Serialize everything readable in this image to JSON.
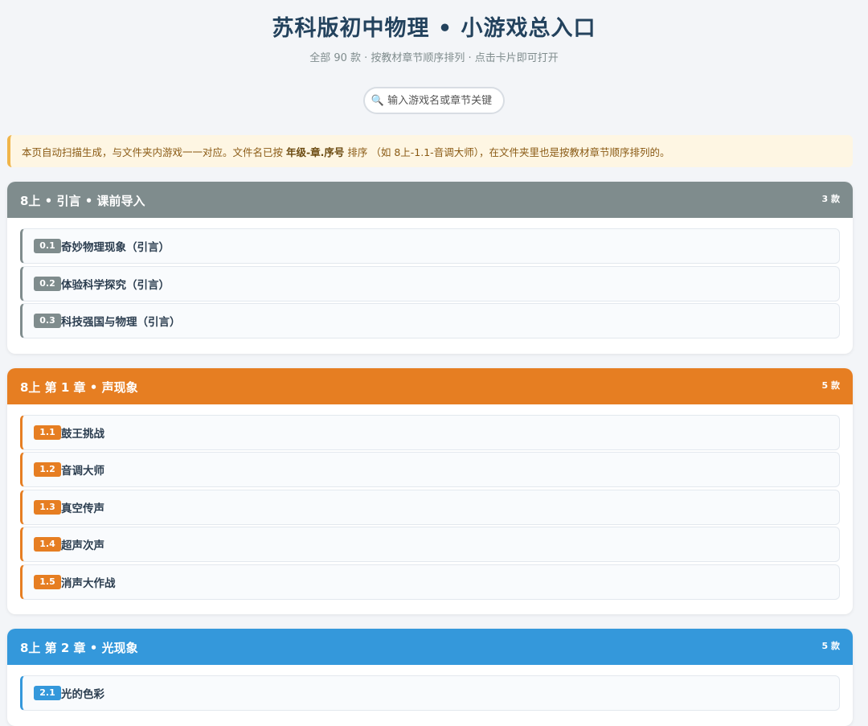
{
  "header": {
    "title": "苏科版初中物理 • 小游戏总入口",
    "subtitle": "全部 90 款 · 按教材章节顺序排列 · 点击卡片即可打开"
  },
  "search": {
    "placeholder": "输入游戏名或章节关键"
  },
  "notice": {
    "text_before": "本页自动扫描生成，与文件夹内游戏一一对应。文件名已按 ",
    "bold": "年级-章.序号",
    "text_after": " 排序 （如 8上-1.1-音调大师），在文件夹里也是按教材章节顺序排列的。"
  },
  "sections": [
    {
      "title": "8上 • 引言 • 课前导入",
      "count": "3 款",
      "color": "#7f8c8d",
      "games": [
        {
          "num": "0.1",
          "name": "奇妙物理现象（引言）"
        },
        {
          "num": "0.2",
          "name": "体验科学探究（引言）"
        },
        {
          "num": "0.3",
          "name": "科技强国与物理（引言）"
        }
      ]
    },
    {
      "title": "8上 第 1 章 • 声现象",
      "count": "5 款",
      "color": "#e67e22",
      "games": [
        {
          "num": "1.1",
          "name": "鼓王挑战"
        },
        {
          "num": "1.2",
          "name": "音调大师"
        },
        {
          "num": "1.3",
          "name": "真空传声"
        },
        {
          "num": "1.4",
          "name": "超声次声"
        },
        {
          "num": "1.5",
          "name": "消声大作战"
        }
      ]
    },
    {
      "title": "8上 第 2 章 • 光现象",
      "count": "5 款",
      "color": "#3498db",
      "games": [
        {
          "num": "2.1",
          "name": "光的色彩"
        }
      ]
    }
  ]
}
